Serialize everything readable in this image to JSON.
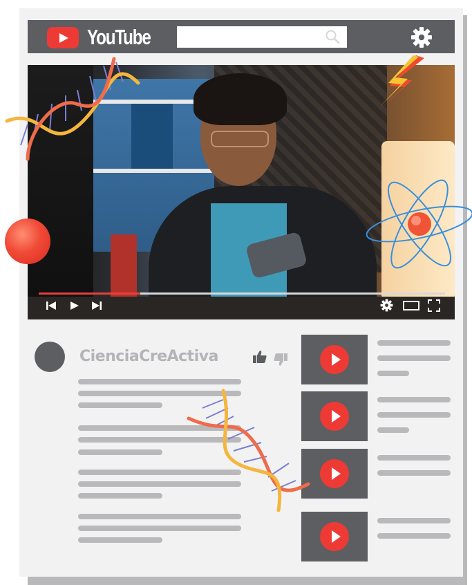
{
  "header": {
    "logo_text": "YouTube",
    "search_placeholder": "",
    "icons": [
      "youtube-logo-icon",
      "search-icon",
      "gear-icon"
    ]
  },
  "video": {
    "progress": 0.25,
    "controls": [
      "skip-back-icon",
      "play-icon",
      "skip-forward-icon",
      "settings-icon",
      "theater-mode-icon",
      "fullscreen-icon"
    ]
  },
  "channel": {
    "name": "CienciaCreActiva"
  },
  "recommendations": {
    "count": 4
  },
  "colors": {
    "accent": "#ee3a35",
    "dark": "#5d5e62",
    "panel": "#f2f2f3",
    "placeholder": "#b9b9bb"
  }
}
